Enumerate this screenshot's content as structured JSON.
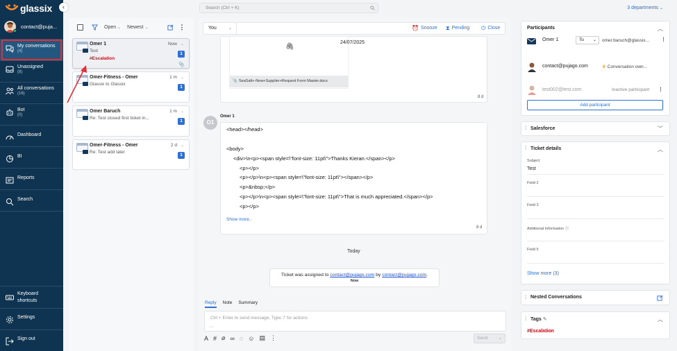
{
  "app": {
    "logo": "glassix",
    "collapse_glyph": "‹"
  },
  "user": {
    "email": "contact@puja..."
  },
  "nav": {
    "my": {
      "label": "My conversations",
      "count": "(4)"
    },
    "unassigned": {
      "label": "Unassigned",
      "count": "(8)"
    },
    "all": {
      "label": "All conversations",
      "count": "(16)"
    },
    "bot": {
      "label": "Bot",
      "count": "(0)"
    },
    "dashboard": {
      "label": "Dashboard"
    },
    "bi": {
      "label": "BI"
    },
    "reports": {
      "label": "Reports"
    },
    "search": {
      "label": "Search"
    },
    "keyboard": {
      "label": "Keyboard shortcuts"
    },
    "settings": {
      "label": "Settings"
    },
    "signout": {
      "label": "Sign out"
    }
  },
  "list": {
    "status": "Open",
    "sort": "Newest",
    "cards": [
      {
        "name": "Omer 1",
        "time": "Now",
        "subject": "Test",
        "badge": "1",
        "tag": "#Escalation"
      },
      {
        "name": "Omer-Fitness - Omer",
        "time": "1 m",
        "subject": "Glassix to Glassix",
        "badge": "1"
      },
      {
        "name": "Omer Baruch",
        "time": "1 m",
        "subject": "Re: Test closed first ticket in...",
        "badge": "1"
      },
      {
        "name": "Omer-Fitness - Omer",
        "time": "2 d",
        "subject": "Re: Test add later",
        "badge": "1"
      }
    ]
  },
  "search": {
    "placeholder": "Search (Ctrl + K)"
  },
  "departments": "3 departments",
  "toolbar": {
    "sender": "You",
    "snooze": "Snooze",
    "pending": "Pending",
    "close": "Close"
  },
  "messages": {
    "attachment": {
      "date": "24/07/2025",
      "file": "SeaSalt+-New+Supplier+Request Form Master.docx",
      "age": "8 d"
    },
    "omer": {
      "initials": "O1",
      "name": "Omer 1",
      "age": "8 d",
      "show_more": "Show more..",
      "lines": [
        "<head></head>",
        "<body>",
        "<div>\\n<p><span style=\\\"font-size: 11pt\\\">Thanks Kieran.</span></p>",
        "<p></p>",
        "<p></p>\\n<p><span style=\\\"font-size: 11pt\\\"></span></p>",
        "<p>&nbsp;</p>",
        "<p></p>\\n<p><span style=\\\"font-size: 11pt\\\">That is much appreciated.</span></p>",
        "<p></p>"
      ]
    },
    "today": "Today",
    "system": {
      "prefix": "Ticket was assigned to",
      "user1": "contact@pujago.com",
      "mid": "by",
      "user2": "contact@pujago.com",
      "end": ".",
      "time": "Now"
    }
  },
  "reply": {
    "tabs": [
      "Reply",
      "Note",
      "Summary"
    ],
    "placeholder": "Ctrl + Enter to send message, Type '/' for actions",
    "send": "Send"
  },
  "right": {
    "participants": {
      "title": "Participants",
      "p1": {
        "name": "Omer 1",
        "select": "To",
        "email": "omer.baruch@glassix..."
      },
      "p2": {
        "name": "contact@pujago.com",
        "role": "Conversation own..."
      },
      "p3": {
        "name": "test002@test.com",
        "status": "Inactive participant"
      },
      "add": "Add participant"
    },
    "salesforce": {
      "title": "Salesforce"
    },
    "ticket": {
      "title": "Ticket details",
      "subject_label": "Subject",
      "subject_value": "Test",
      "field2": "Field 2",
      "field3": "Field 3",
      "additional": "Additional Information",
      "field5": "Field 5",
      "show_more": "Show more (3)"
    },
    "nested": {
      "title": "Nested Conversations"
    },
    "tags": {
      "title": "Tags",
      "value": "#Escalation"
    }
  },
  "colors": {
    "sidebar": "#0e3451",
    "accent": "#2d6fd2",
    "tag": "#c1121f",
    "highlight": "#e0303a"
  }
}
